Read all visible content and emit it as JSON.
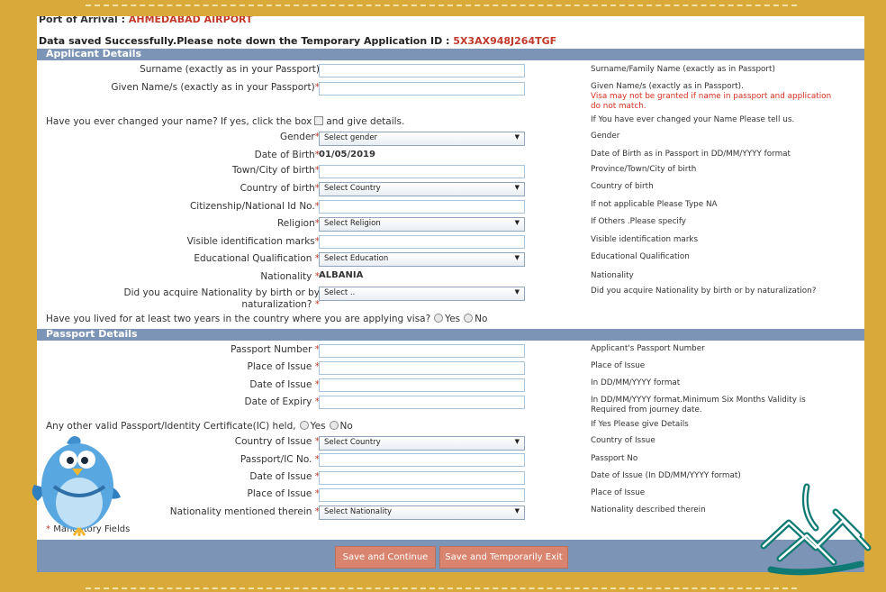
{
  "header": {
    "port_label": "Port of Arrival :",
    "port_value": "AHMEDABAD AIRPORT",
    "saved_msg": "Data saved Successfully.Please note down the Temporary Application ID :",
    "temp_id": "5X3AX948J264TGF"
  },
  "sections": {
    "applicant": "Applicant Details",
    "passport": "Passport Details"
  },
  "applicant": {
    "surname_label": "Surname (exactly as in your Passport)",
    "surname_hint": "Surname/Family Name (exactly as in Passport)",
    "given_label": "Given Name/s (exactly as in your Passport)",
    "given_hint1": "Given Name/s (exactly as in Passport).",
    "given_hint2": "Visa may not be granted if name in passport and application",
    "given_hint3": "do not match.",
    "changed_name_q": "Have you ever changed your name? If yes, click the box",
    "changed_name_q2": "and give details.",
    "changed_name_hint": "If You have ever changed your Name Please tell us.",
    "gender_label": "Gender",
    "gender_value": "Select gender",
    "gender_hint": "Gender",
    "dob_label": "Date of Birth",
    "dob_value": "01/05/2019",
    "dob_hint": "Date of Birth as in Passport in DD/MM/YYYY format",
    "town_label": "Town/City of birth",
    "town_hint": "Province/Town/City of birth",
    "country_label": "Country of birth",
    "country_value": "Select Country",
    "country_hint": "Country of birth",
    "citizen_label": "Citizenship/National Id No.",
    "citizen_hint": "If not applicable Please Type NA",
    "religion_label": "Religion",
    "religion_value": "Select Religion",
    "religion_hint": "If Others .Please specify",
    "marks_label": "Visible identification marks",
    "marks_hint": "Visible identification marks",
    "edu_label": "Educational Qualification",
    "edu_value": "Select Education",
    "edu_hint": "Educational Qualification",
    "nationality_label": "Nationality",
    "nationality_value": "ALBANIA",
    "nationality_hint": "Nationality",
    "acquire_label1": "Did you acquire Nationality by birth or by",
    "acquire_label2": "naturalization?",
    "acquire_value": "Select ..",
    "acquire_hint": "Did you acquire Nationality by birth or by naturalization?",
    "lived_q": "Have you lived for at least two years in the country where you are applying visa?",
    "yes": "Yes",
    "no": "No"
  },
  "passport": {
    "number_label": "Passport Number",
    "number_hint": "Applicant's Passport Number",
    "place_label": "Place of Issue",
    "place_hint": "Place of Issue",
    "doi_label": "Date of Issue",
    "doi_hint": "In DD/MM/YYYY format",
    "doe_label": "Date of Expiry",
    "doe_hint1": "In DD/MM/YYYY format.Minimum Six Months Validity is",
    "doe_hint2": "Required from journey date.",
    "other_q": "Any other valid Passport/Identity Certificate(IC) held,",
    "other_hint": "If Yes Please give Details",
    "yes": "Yes",
    "no": "No",
    "ic_country_label": "Country of Issue",
    "ic_country_value": "Select Country",
    "ic_country_hint": "Country of Issue",
    "ic_no_label": "Passport/IC No.",
    "ic_no_hint": "Passport No",
    "ic_doi_label": "Date of Issue",
    "ic_doi_hint": "Date of Issue (In DD/MM/YYYY format)",
    "ic_place_label": "Place of Issue",
    "ic_place_hint": "Place of Issue",
    "ic_nat_label": "Nationality mentioned therein",
    "ic_nat_value": "Select Nationality",
    "ic_nat_hint": "Nationality described therein"
  },
  "footer": {
    "mandatory": "Mandatory Fields",
    "save_continue": "Save and Continue",
    "save_exit": "Save and Temporarily Exit"
  },
  "colors": {
    "band": "#7c94b5",
    "accent_red": "#c0392b",
    "button": "#d9846e",
    "background": "#d9a93a"
  }
}
